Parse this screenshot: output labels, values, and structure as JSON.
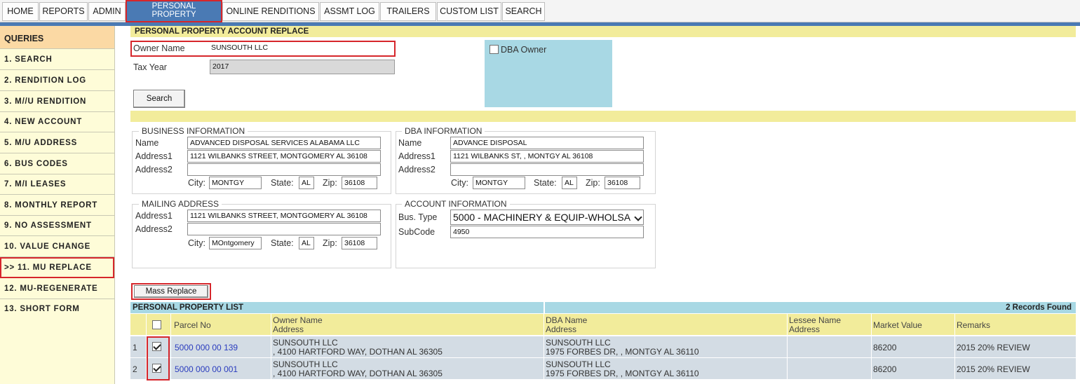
{
  "nav": {
    "items": [
      "HOME",
      "REPORTS",
      "ADMIN",
      "PERSONAL PROPERTY",
      "ONLINE RENDITIONS",
      "ASSMT LOG",
      "TRAILERS",
      "CUSTOM LIST",
      "SEARCH"
    ],
    "active_line1": "PERSONAL",
    "active_line2": "PROPERTY"
  },
  "sidebar": {
    "header": "QUERIES",
    "items": [
      "1. SEARCH",
      "2. RENDITION LOG",
      "3. M//U RENDITION",
      "4. NEW ACCOUNT",
      "5. M/U ADDRESS",
      "6. BUS CODES",
      "7. M/I LEASES",
      "8. MONTHLY REPORT",
      "9. NO ASSESSMENT",
      "10. VALUE CHANGE",
      ">> 11. MU REPLACE",
      "12. MU-REGENERATE",
      "13. SHORT FORM"
    ],
    "active_index": 10
  },
  "page": {
    "title": "PERSONAL PROPERTY ACCOUNT REPLACE"
  },
  "search_form": {
    "owner_label": "Owner Name",
    "owner_value": "SUNSOUTH LLC",
    "tax_year_label": "Tax Year",
    "tax_year_value": "2017",
    "search_button": "Search",
    "dba_owner_label": "DBA Owner",
    "dba_owner_checked": false
  },
  "business": {
    "legend": "BUSINESS INFORMATION",
    "name_label": "Name",
    "name": "ADVANCED DISPOSAL SERVICES ALABAMA LLC",
    "address1_label": "Address1",
    "address1": "1121 WILBANKS STREET, MONTGOMERY AL 36108",
    "address2_label": "Address2",
    "address2": "",
    "city_label": "City:",
    "city": "MONTGY",
    "state_label": "State:",
    "state": "AL",
    "zip_label": "Zip:",
    "zip": "36108"
  },
  "dba": {
    "legend": "DBA INFORMATION",
    "name_label": "Name",
    "name": "ADVANCE DISPOSAL",
    "address1_label": "Address1",
    "address1": "1121 WILBANKS ST, , MONTGY AL 36108",
    "address2_label": "Address2",
    "address2": "",
    "city_label": "City:",
    "city": "MONTGY",
    "state_label": "State:",
    "state": "AL",
    "zip_label": "Zip:",
    "zip": "36108"
  },
  "mailing": {
    "legend": "MAILING ADDRESS",
    "address1_label": "Address1",
    "address1": "1121 WILBANKS STREET, MONTGOMERY AL 36108",
    "address2_label": "Address2",
    "address2": "",
    "city_label": "City:",
    "city": "MOntgomery",
    "state_label": "State:",
    "state": "AL",
    "zip_label": "Zip:",
    "zip": "36108"
  },
  "account": {
    "legend": "ACCOUNT INFORMATION",
    "bus_type_label": "Bus. Type",
    "bus_type": "5000 - MACHINERY & EQUIP-WHOLSA",
    "subcode_label": "SubCode",
    "subcode": "4950"
  },
  "mass_replace_button": "Mass Replace",
  "list": {
    "title": "PERSONAL PROPERTY LIST",
    "records_found": "2 Records Found",
    "headers": {
      "parcel": "Parcel No",
      "owner_line1": "Owner Name",
      "owner_line2": "Address",
      "dba_line1": "DBA Name",
      "dba_line2": "Address",
      "lessee_line1": "Lessee Name",
      "lessee_line2": "Address",
      "market_value": "Market Value",
      "remarks": "Remarks"
    },
    "select_all_checked": false,
    "rows": [
      {
        "num": "1",
        "checked": true,
        "parcel": "5000 000 00 139",
        "owner_name": "SUNSOUTH LLC",
        "owner_address": ", 4100 HARTFORD WAY, DOTHAN AL 36305",
        "dba_name": "SUNSOUTH LLC",
        "dba_address": "1975 FORBES DR, , MONTGY AL 36110",
        "lessee": "",
        "market_value": "86200",
        "remarks": "2015 20% REVIEW"
      },
      {
        "num": "2",
        "checked": true,
        "parcel": "5000 000 00 001",
        "owner_name": "SUNSOUTH LLC",
        "owner_address": ", 4100 HARTFORD WAY, DOTHAN AL 36305",
        "dba_name": "SUNSOUTH LLC",
        "dba_address": "1975 FORBES DR, , MONTGY AL 36110",
        "lessee": "",
        "market_value": "86200",
        "remarks": "2015 20% REVIEW"
      }
    ]
  }
}
